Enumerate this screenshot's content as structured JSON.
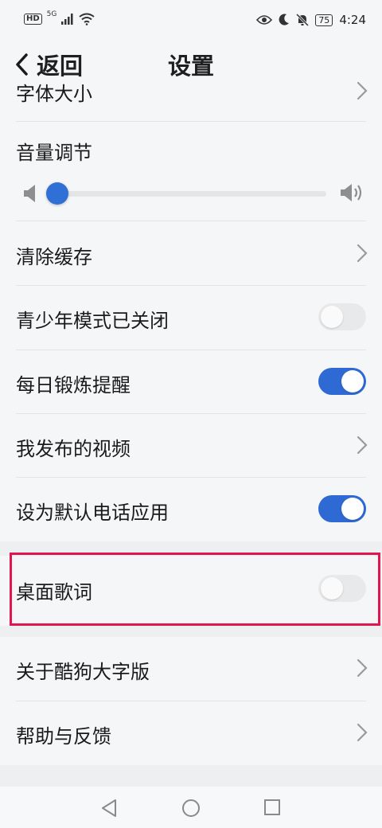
{
  "status_bar": {
    "hd": "HD",
    "signal": "5G",
    "battery": "75",
    "time": "4:24"
  },
  "header": {
    "back_label": "返回",
    "title": "设置"
  },
  "rows": [
    {
      "label": "字体大小"
    },
    {
      "label": "音量调节"
    },
    {
      "label": "清除缓存"
    },
    {
      "label": "青少年模式已关闭",
      "toggle": "off"
    },
    {
      "label": "每日锻炼提醒",
      "toggle": "on"
    },
    {
      "label": "我发布的视频"
    },
    {
      "label": "设为默认电话应用",
      "toggle": "on"
    },
    {
      "label": "桌面歌词",
      "toggle": "off"
    },
    {
      "label": "关于酷狗大字版"
    },
    {
      "label": "帮助与反馈"
    }
  ],
  "volume": {
    "level": 0.0
  },
  "colors": {
    "accent": "#2f69d3",
    "highlight": "#e0174e"
  }
}
